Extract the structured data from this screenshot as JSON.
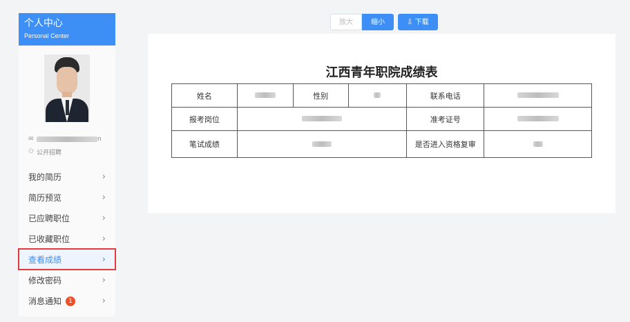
{
  "sidebar": {
    "title": "个人中心",
    "subtitle": "Personal Center",
    "email_suffix": "n",
    "recruit_type": "公开招聘",
    "menu": [
      {
        "label": "我的简历"
      },
      {
        "label": "简历预览"
      },
      {
        "label": "已应聘职位"
      },
      {
        "label": "已收藏职位"
      },
      {
        "label": "查看成绩",
        "active": true
      },
      {
        "label": "修改密码"
      },
      {
        "label": "消息通知",
        "badge": "1"
      }
    ],
    "chevron": "›",
    "accent": "#3d8ff6",
    "highlight_border": "#e4393c"
  },
  "toolbar": {
    "zoom_in": "放大",
    "zoom_out": "缩小",
    "download": "下载",
    "download_icon": "cloud-download-icon"
  },
  "report": {
    "title": "江西青年职院成绩表",
    "labels": {
      "name": "姓名",
      "gender": "性别",
      "phone": "联系电话",
      "position": "报考岗位",
      "ticket": "准考证号",
      "written_score": "笔试成绩",
      "review": "是否进入资格复审"
    }
  }
}
